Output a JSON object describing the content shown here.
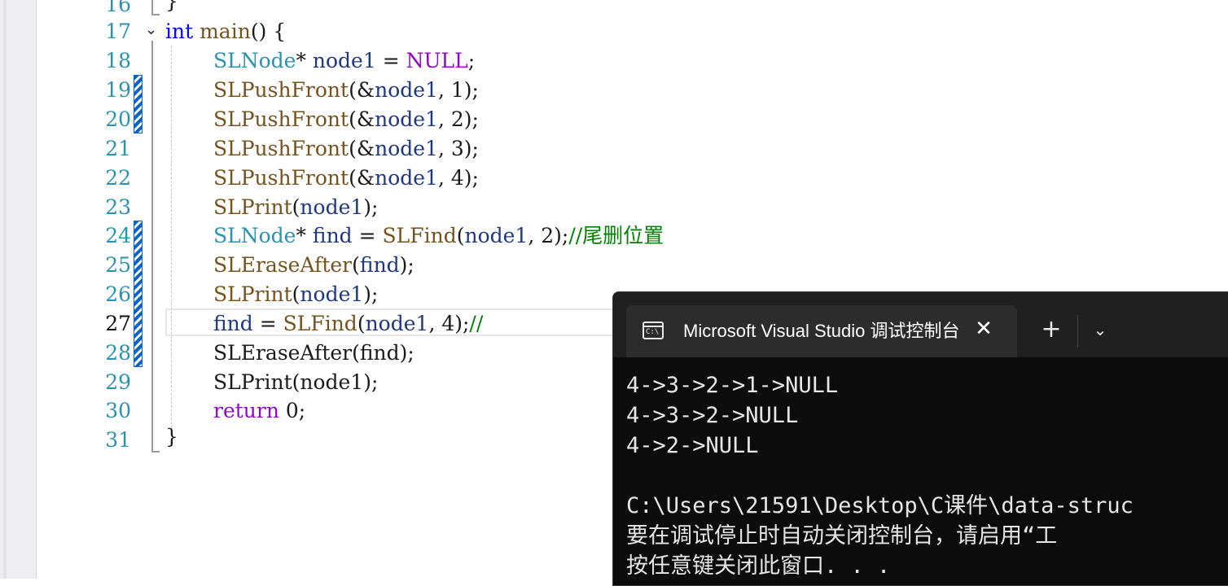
{
  "editor": {
    "line_numbers": [
      "16",
      "17",
      "18",
      "19",
      "20",
      "21",
      "22",
      "23",
      "24",
      "25",
      "26",
      "27",
      "28",
      "29",
      "30",
      "31"
    ],
    "top_fragment": "}",
    "lines": {
      "l17": {
        "kw": "int",
        "name": " main",
        "rest": "() {"
      },
      "l18": {
        "type": "SLNode",
        "rest1": "* ",
        "var": "node1",
        "rest2": " = ",
        "macro": "NULL",
        "rest3": ";"
      },
      "l19": {
        "fn": "SLPushFront",
        "open": "(&",
        "var": "node1",
        "args": ", 1);"
      },
      "l20": {
        "fn": "SLPushFront",
        "open": "(&",
        "var": "node1",
        "args": ", 2);"
      },
      "l21": {
        "fn": "SLPushFront",
        "open": "(&",
        "var": "node1",
        "args": ", 3);"
      },
      "l22": {
        "fn": "SLPushFront",
        "open": "(&",
        "var": "node1",
        "args": ", 4);"
      },
      "l23": {
        "fn": "SLPrint",
        "open": "(",
        "var": "node1",
        "args": ");"
      },
      "l24": {
        "type": "SLNode",
        "rest1": "* ",
        "var": "find",
        "rest2": " = ",
        "fn": "SLFind",
        "open": "(",
        "var2": "node1",
        "args": ", 2);",
        "comment": "//尾删位置"
      },
      "l25": {
        "fn": "SLEraseAfter",
        "open": "(",
        "var": "find",
        "args": ");"
      },
      "l26": {
        "fn": "SLPrint",
        "open": "(",
        "var": "node1",
        "args": ");"
      },
      "l27": {
        "var": "find",
        "rest": " = ",
        "fn": "SLFind",
        "open": "(",
        "var2": "node1",
        "args": ", 4);",
        "comment": "//"
      },
      "l28": {
        "text": "SLEraseAfter(find);"
      },
      "l29": {
        "text": "SLPrint(node1);"
      },
      "l30": {
        "kw": "return",
        "rest": " 0;"
      },
      "l31": {
        "text": "}"
      }
    }
  },
  "terminal": {
    "tab_title": "Microsoft Visual Studio 调试控制台",
    "icon_label": "C:\\",
    "close_glyph": "✕",
    "new_tab_glyph": "+",
    "dropdown_glyph": "⌄",
    "output": [
      "4->3->2->1->NULL",
      "4->3->2->NULL",
      "4->2->NULL",
      "",
      "C:\\Users\\21591\\Desktop\\C课件\\data-struc",
      "要在调试停止时自动关闭控制台，请启用“工",
      "按任意键关闭此窗口. . ."
    ]
  },
  "colors": {
    "type": "#2b91af",
    "function": "#74531f",
    "parameter": "#1f377f",
    "keyword": "#8f08c4",
    "comment": "#008000",
    "change_marker": "#0a64c8",
    "terminal_bg": "#0c0c0c"
  }
}
